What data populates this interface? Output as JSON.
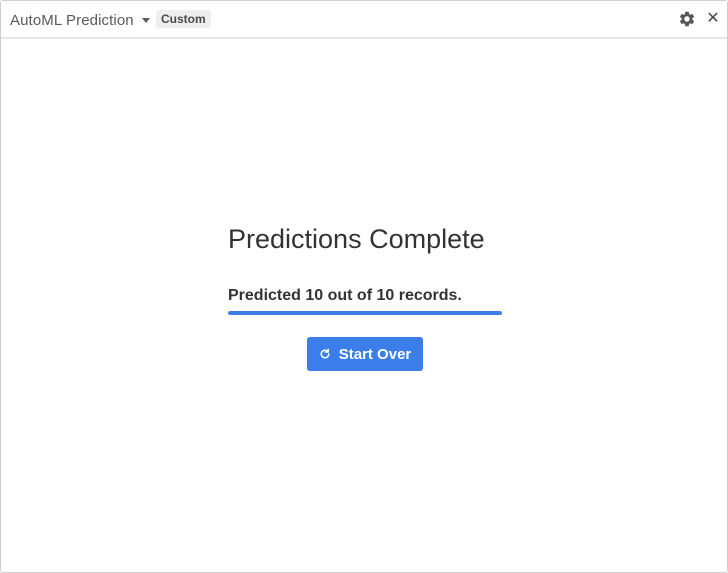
{
  "header": {
    "app_title": "AutoML Prediction",
    "badge": "Custom",
    "icons": [
      "chevron-down-icon",
      "gear-icon",
      "close-icon"
    ],
    "close_glyph": "✕"
  },
  "main": {
    "heading": "Predictions Complete",
    "status": "Predicted 10 out of 10 records.",
    "progress": {
      "completed": 10,
      "total": 10,
      "fraction": 1.0
    },
    "start_over_label": "Start Over",
    "start_over_icon": "refresh-icon"
  },
  "colors": {
    "accent": "#3b7de9",
    "text": "#333333",
    "badge_bg": "#eeeeee"
  }
}
